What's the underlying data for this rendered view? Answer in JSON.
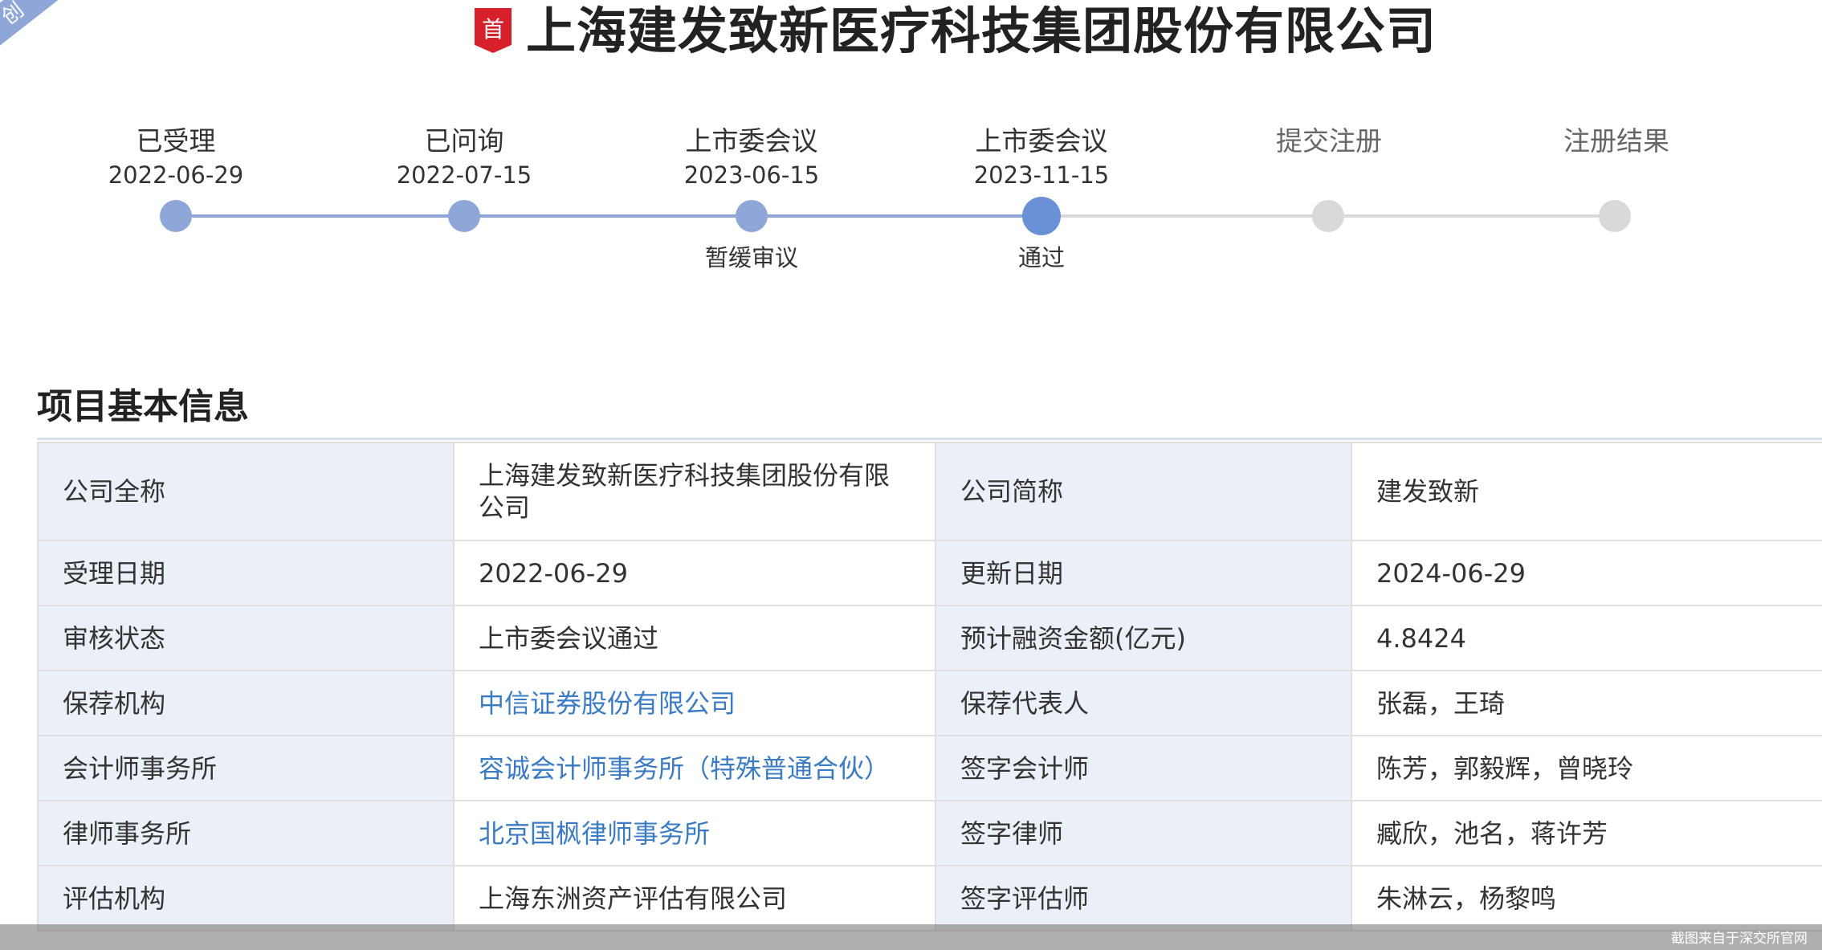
{
  "ribbon": {
    "text": "创"
  },
  "header": {
    "badge": "首",
    "company_title": "上海建发致新医疗科技集团股份有限公司"
  },
  "timeline": {
    "steps": [
      {
        "label": "已受理",
        "date": "2022-06-29",
        "status": "done",
        "note": ""
      },
      {
        "label": "已问询",
        "date": "2022-07-15",
        "status": "done",
        "note": ""
      },
      {
        "label": "上市委会议",
        "date": "2023-06-15",
        "status": "done",
        "note": "暂缓审议"
      },
      {
        "label": "上市委会议",
        "date": "2023-11-15",
        "status": "current",
        "note": "通过"
      },
      {
        "label": "提交注册",
        "date": "",
        "status": "pending",
        "note": ""
      },
      {
        "label": "注册结果",
        "date": "",
        "status": "pending",
        "note": ""
      }
    ]
  },
  "section": {
    "title": "项目基本信息"
  },
  "info": {
    "rows": [
      {
        "l1": "公司全称",
        "v1": "上海建发致新医疗科技集团股份有限公司",
        "l2": "公司简称",
        "v2": "建发致新"
      },
      {
        "l1": "受理日期",
        "v1": "2022-06-29",
        "l2": "更新日期",
        "v2": "2024-06-29"
      },
      {
        "l1": "审核状态",
        "v1": "上市委会议通过",
        "l2": "预计融资金额(亿元)",
        "v2": "4.8424"
      },
      {
        "l1": "保荐机构",
        "v1": "中信证券股份有限公司",
        "l2": "保荐代表人",
        "v2": "张磊，王琦"
      },
      {
        "l1": "会计师事务所",
        "v1": "容诚会计师事务所（特殊普通合伙）",
        "l2": "签字会计师",
        "v2": "陈芳，郭毅辉，曾晓玲"
      },
      {
        "l1": "律师事务所",
        "v1": "北京国枫律师事务所",
        "l2": "签字律师",
        "v2": "臧欣，池名，蒋许芳"
      },
      {
        "l1": "评估机构",
        "v1": "上海东洲资产评估有限公司",
        "l2": "签字评估师",
        "v2": "朱淋云，杨黎鸣"
      }
    ]
  },
  "footer": {
    "note": "截图来自于深交所官网"
  },
  "colors": {
    "accent": "#6a90d6",
    "done": "#8ea7d8",
    "pending": "#d9d9d9",
    "link": "#3b7bc4",
    "label_bg": "#ebf0f8",
    "badge_red": "#d6202b"
  }
}
